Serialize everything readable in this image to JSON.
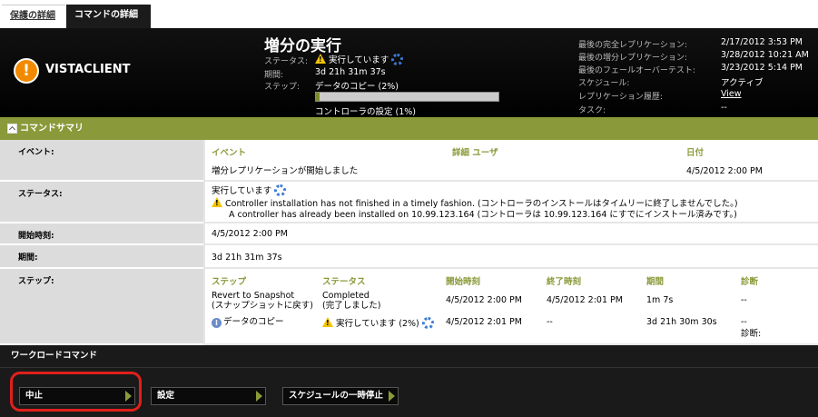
{
  "tabs": [
    {
      "label": "保護の詳細"
    },
    {
      "label": "コマンドの詳細"
    }
  ],
  "header": {
    "client_name": "VISTACLIENT",
    "title": "増分の実行",
    "status_label": "ステータス:",
    "status_value": "実行しています",
    "duration_label": "期間:",
    "duration_value": "3d 21h 31m 37s",
    "step_label": "ステップ:",
    "step_value": "データのコピー (2%)",
    "step_progress": 0.02,
    "substep_value": "コントローラの設定 (1%)",
    "right": [
      {
        "label": "最後の完全レプリケーション:",
        "value": "2/17/2012 3:53 PM"
      },
      {
        "label": "最後の増分レプリケーション:",
        "value": "3/28/2012 10:21 AM"
      },
      {
        "label": "最後のフェールオーバーテスト:",
        "value": "3/23/2012 5:14 PM"
      },
      {
        "label": "スケジュール:",
        "value": "アクティブ"
      },
      {
        "label": "レプリケーション履歴:",
        "value": "View"
      },
      {
        "label": "タスク:",
        "value": "--"
      }
    ]
  },
  "summary": {
    "title": "コマンドサマリ"
  },
  "events": {
    "label": "イベント:",
    "headers": [
      "イベント",
      "詳細  ユーザ",
      "日付"
    ],
    "rows": [
      {
        "event": "増分レプリケーションが開始しました",
        "date": "4/5/2012 2:00 PM"
      }
    ]
  },
  "status": {
    "label": "ステータス:",
    "value": "実行しています",
    "warning1": "Controller installation has not finished in a timely fashion. (コントローラのインストールはタイムリーに終了しませんでした。)",
    "warning2": "A controller has already been installed on 10.99.123.164 (コントローラは 10.99.123.164 にすでにインストール済みです。)"
  },
  "start_time": {
    "label": "開始時刻:",
    "value": "4/5/2012 2:00 PM"
  },
  "duration": {
    "label": "期間:",
    "value": "3d 21h 31m 37s"
  },
  "steps": {
    "label": "ステップ:",
    "headers": [
      "ステップ",
      "ステータス",
      "開始時刻",
      "終了時刻",
      "期間",
      "診断"
    ],
    "rows": [
      {
        "step": "Revert to Snapshot",
        "step2": "(スナップショットに戻す)",
        "status": "Completed",
        "status2": "(完了しました)",
        "start": "4/5/2012 2:00 PM",
        "end": "4/5/2012 2:01 PM",
        "duration": "1m 7s",
        "diag": "--"
      },
      {
        "step": "データのコピー",
        "status": "実行しています (2%)",
        "start": "4/5/2012 2:01 PM",
        "end": "--",
        "duration": "3d 21h 30m 30s",
        "diag": "--",
        "diag2": "診断:"
      }
    ]
  },
  "workload": {
    "title": "ワークロードコマンド",
    "buttons": [
      {
        "label": "中止"
      },
      {
        "label": "設定"
      },
      {
        "label": "スケジュールの一時停止"
      }
    ]
  },
  "colors": {
    "accent": "#8a9a3a",
    "highlight": "#e0201a",
    "warning": "#f2c300",
    "alert": "#f28a00"
  }
}
